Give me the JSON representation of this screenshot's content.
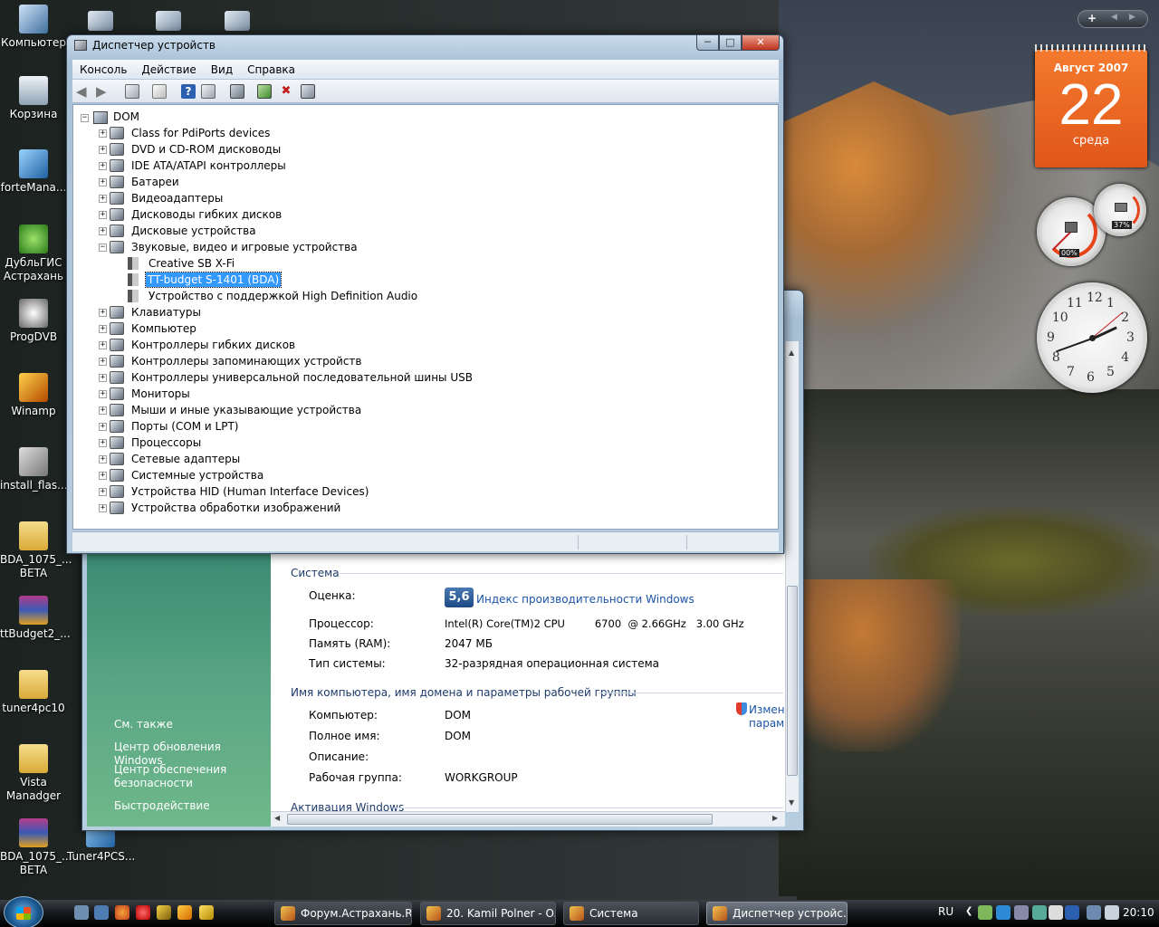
{
  "desktop": {
    "icons": [
      {
        "label": "Компьютер",
        "icon": "computer-icon"
      },
      {
        "label": "Корзина",
        "icon": "recycle-bin-icon"
      },
      {
        "label": "forteMana...",
        "icon": "shortcut-icon"
      },
      {
        "label": "ДубльГИС Астрахань",
        "icon": "2gis-icon"
      },
      {
        "label": "ProgDVB",
        "icon": "satellite-icon"
      },
      {
        "label": "Winamp",
        "icon": "winamp-icon"
      },
      {
        "label": "install_flas...",
        "icon": "installer-icon"
      },
      {
        "label": "BDA_1075_... BETA",
        "icon": "folder-icon"
      },
      {
        "label": "ttBudget2_...",
        "icon": "archive-icon"
      },
      {
        "label": "tuner4pc10",
        "icon": "folder-icon"
      },
      {
        "label": "Vista Manadger",
        "icon": "folder-icon"
      },
      {
        "label": "BDA_1075_... BETA",
        "icon": "archive-icon"
      },
      {
        "label": "Tuner4PCS...",
        "icon": "shortcut-icon"
      }
    ]
  },
  "device_manager": {
    "title": "Диспетчер устройств",
    "menu": [
      "Консоль",
      "Действие",
      "Вид",
      "Справка"
    ],
    "root": "DOM",
    "tree": [
      {
        "label": "Class for PdiPorts devices",
        "icon": "port-icon"
      },
      {
        "label": "DVD и CD-ROM дисководы",
        "icon": "cdrom-icon"
      },
      {
        "label": "IDE ATA/ATAPI контроллеры",
        "icon": "ide-icon"
      },
      {
        "label": "Батареи",
        "icon": "battery-icon"
      },
      {
        "label": "Видеоадаптеры",
        "icon": "display-adapter-icon"
      },
      {
        "label": "Дисководы гибких дисков",
        "icon": "floppy-icon"
      },
      {
        "label": "Дисковые устройства",
        "icon": "disk-icon"
      },
      {
        "label": "Звуковые, видео и игровые устройства",
        "icon": "speaker-icon",
        "expanded": true,
        "children": [
          "Creative SB X-Fi",
          "TT-budget S-1401 (BDA)",
          "Устройство с поддержкой High Definition Audio"
        ]
      },
      {
        "label": "Клавиатуры",
        "icon": "keyboard-icon"
      },
      {
        "label": "Компьютер",
        "icon": "computer-icon"
      },
      {
        "label": "Контроллеры гибких дисков",
        "icon": "floppy-controller-icon"
      },
      {
        "label": "Контроллеры запоминающих устройств",
        "icon": "storage-controller-icon"
      },
      {
        "label": "Контроллеры универсальной последовательной шины USB",
        "icon": "usb-icon"
      },
      {
        "label": "Мониторы",
        "icon": "monitor-icon"
      },
      {
        "label": "Мыши и иные указывающие устройства",
        "icon": "mouse-icon"
      },
      {
        "label": "Порты (COM и LPT)",
        "icon": "port-icon"
      },
      {
        "label": "Процессоры",
        "icon": "cpu-icon"
      },
      {
        "label": "Сетевые адаптеры",
        "icon": "network-icon"
      },
      {
        "label": "Системные устройства",
        "icon": "system-icon"
      },
      {
        "label": "Устройства HID (Human Interface Devices)",
        "icon": "hid-icon"
      },
      {
        "label": "Устройства обработки изображений",
        "icon": "camera-icon"
      }
    ],
    "selected_child": "TT-budget S-1401 (BDA)"
  },
  "system": {
    "section_system": "Система",
    "rating_label": "Оценка:",
    "rating_value": "5,6",
    "rating_link": "Индекс производительности Windows",
    "cpu_label": "Процессор:",
    "cpu_value": "Intel(R) Core(TM)2 CPU         6700  @ 2.66GHz   3.00 GHz",
    "ram_label": "Память (RAM):",
    "ram_value": "2047 МБ",
    "type_label": "Тип системы:",
    "type_value": "32-разрядная операционная система",
    "section_name": "Имя компьютера, имя домена и параметры рабочей группы",
    "computer_label": "Компьютер:",
    "computer_value": "DOM",
    "fullname_label": "Полное имя:",
    "fullname_value": "DOM",
    "desc_label": "Описание:",
    "workgroup_label": "Рабочая группа:",
    "workgroup_value": "WORKGROUP",
    "change_link_1": "Измен",
    "change_link_2": "парам",
    "section_activation": "Активация Windows",
    "see_also": "См. также",
    "links": [
      "Центр обновления Windows",
      "Центр обеспечения безопасности",
      "Быстродействие"
    ]
  },
  "gadgets": {
    "calendar_month": "Август 2007",
    "calendar_day": "22",
    "calendar_weekday": "среда",
    "cpu_gauge": "00%",
    "ram_gauge": "37%",
    "clock_numbers": [
      "12",
      "1",
      "2",
      "3",
      "4",
      "5",
      "6",
      "7",
      "8",
      "9",
      "10",
      "11"
    ]
  },
  "sidebar_controls": {
    "add": "+",
    "prev": "◀",
    "next": "▶"
  },
  "taskbar": {
    "buttons": [
      {
        "label": "Форум.Астрахань.R...",
        "icon": "firefox-icon"
      },
      {
        "label": "20. Kamil Polner - O...",
        "icon": "winamp-icon"
      },
      {
        "label": "Система",
        "icon": "system-icon"
      },
      {
        "label": "Диспетчер устройс...",
        "icon": "device-manager-icon",
        "active": true
      }
    ],
    "lang": "RU",
    "time": "20:10"
  },
  "colors": {
    "selection": "#3399ff",
    "calendar": "#e8621f",
    "sys_left_pane": "#4f9a7b",
    "link": "#1c55a8"
  }
}
